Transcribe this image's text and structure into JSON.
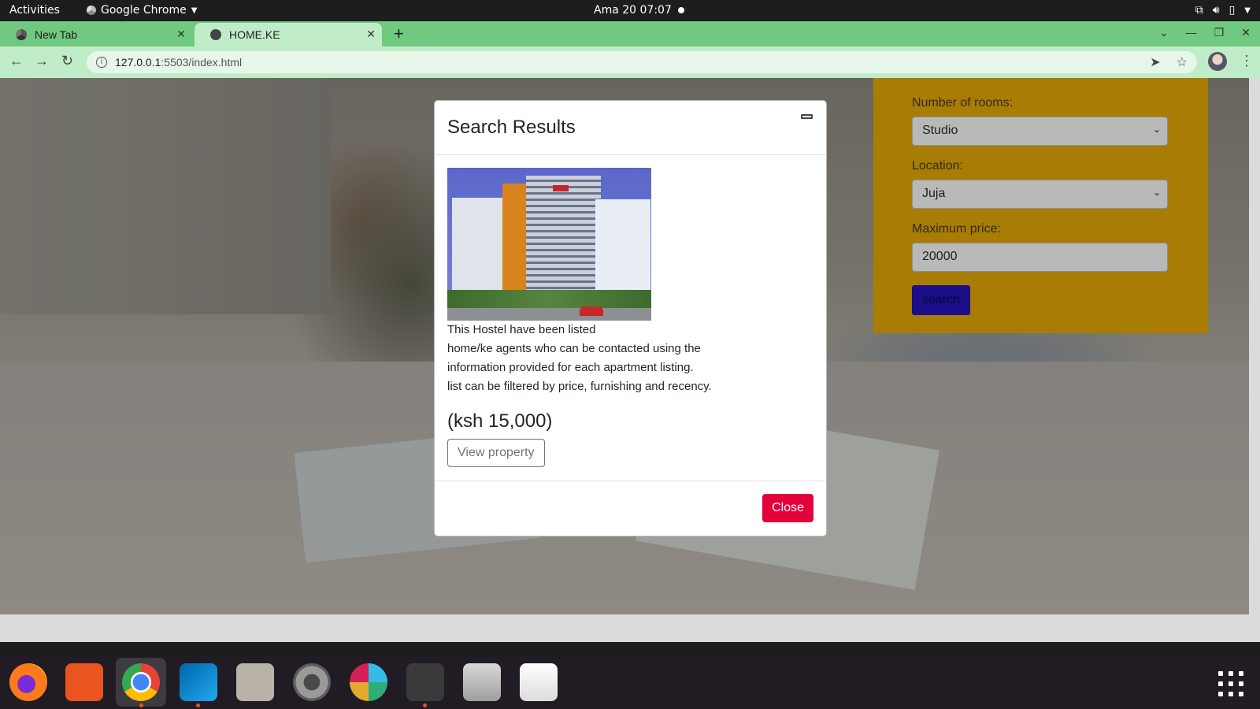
{
  "topbar": {
    "activities": "Activities",
    "app_menu": "Google Chrome",
    "clock": "Ama 20  07:07"
  },
  "tabs": [
    {
      "label": "New Tab",
      "active": false
    },
    {
      "label": "HOME.KE",
      "active": true
    }
  ],
  "address_bar": {
    "host": "127.0.0.1",
    "path": ":5503/index.html"
  },
  "search_form": {
    "rooms_label": "Number of rooms:",
    "rooms_value": "Studio",
    "location_label": "Location:",
    "location_value": "Juja",
    "price_label": "Maximum price:",
    "price_value": "20000",
    "search_button": "search",
    "panel_color": "#f5b60a",
    "button_color": "#2a14d6"
  },
  "modal": {
    "title": "Search Results",
    "description": "This Hostel have been listed home/ke agents who can be contacted using the information provided for each apartment listing. list can be filtered by price, furnishing and recency.",
    "description_lines": [
      "This Hostel have been listed",
      "home/ke agents who can be contacted using the",
      "information provided for each apartment listing.",
      "list can be filtered by price, furnishing and recency."
    ],
    "price": "(ksh 15,000)",
    "view_button": "View property",
    "close_button": "Close",
    "close_color": "#e4003a"
  },
  "dock": {
    "apps": [
      "firefox",
      "app-center",
      "google-chrome",
      "vscode",
      "files",
      "settings",
      "slack",
      "terminal",
      "image-viewer",
      "text-editor"
    ]
  },
  "colors": {
    "tab_strip": "#6fc97f",
    "toolbar": "#c1ecc8"
  }
}
